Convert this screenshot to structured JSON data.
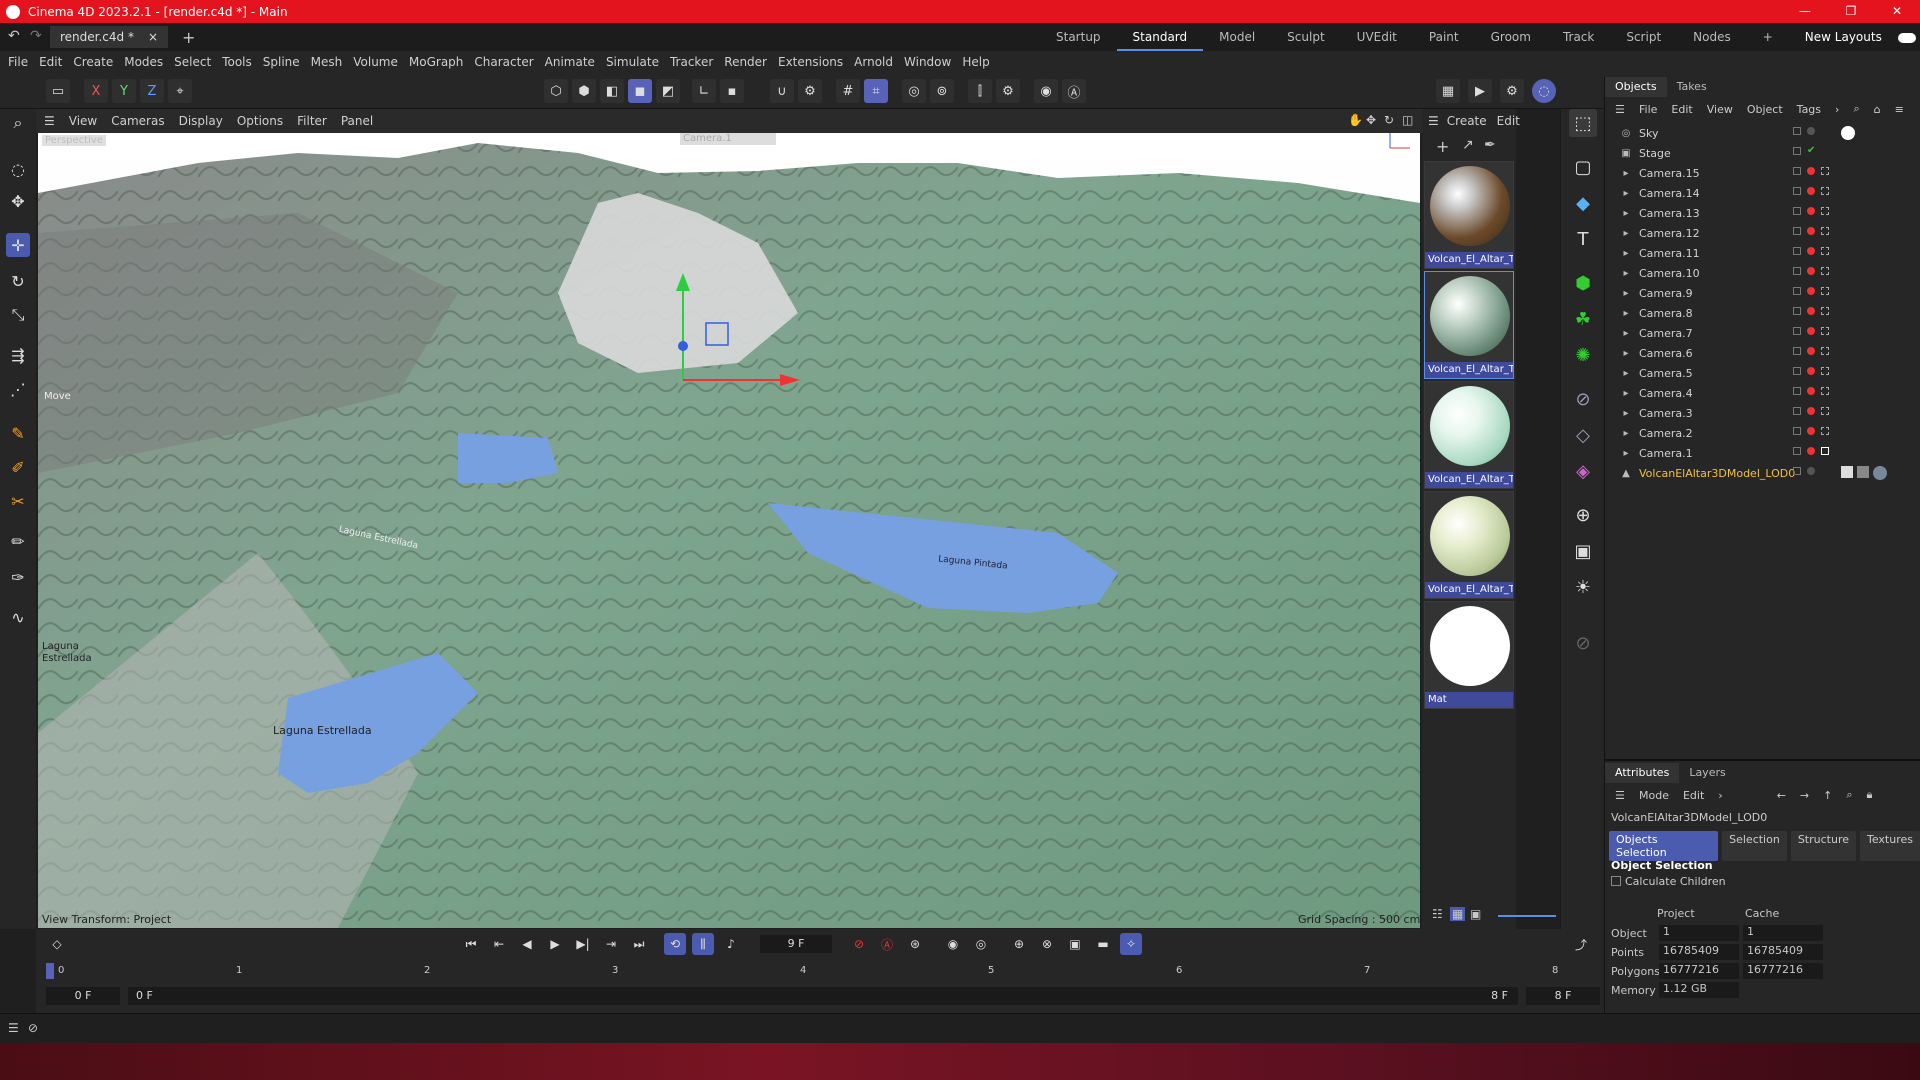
{
  "window": {
    "title": "Cinema 4D 2023.2.1 - [render.c4d *] - Main"
  },
  "doc_tab": {
    "name": "render.c4d *",
    "close": "×",
    "add": "+"
  },
  "layouts": {
    "items": [
      "Startup",
      "Standard",
      "Model",
      "Sculpt",
      "UVEdit",
      "Paint",
      "Groom",
      "Track",
      "Script",
      "Nodes"
    ],
    "add": "+",
    "new_layouts": "New Layouts",
    "active": "Standard"
  },
  "menu": [
    "File",
    "Edit",
    "Create",
    "Modes",
    "Select",
    "Tools",
    "Spline",
    "Mesh",
    "Volume",
    "MoGraph",
    "Character",
    "Animate",
    "Simulate",
    "Tracker",
    "Render",
    "Extensions",
    "Arnold",
    "Window",
    "Help"
  ],
  "toolbar": {
    "x": "X",
    "y": "Y",
    "z": "Z"
  },
  "viewport": {
    "menu": [
      "View",
      "Cameras",
      "Display",
      "Options",
      "Filter",
      "Panel"
    ],
    "label": "Perspective",
    "camera": "Camera.1",
    "status_left": "View Transform: Project",
    "status_right": "Grid Spacing : 500 cm",
    "move_label": "Move",
    "map_labels": [
      "Laguna Estrellada",
      "Laguna Pintada",
      "Laguna",
      "Estrellada"
    ]
  },
  "materials": {
    "menu": [
      "Create",
      "Edit"
    ],
    "items": [
      {
        "name": "Volcan_El_Altar_Te",
        "color": "#6b4a2a"
      },
      {
        "name": "Volcan_El_Altar_Te",
        "color": "#7a9a88"
      },
      {
        "name": "Volcan_El_Altar_Te",
        "color": "#a8d8c0"
      },
      {
        "name": "Volcan_El_Altar_Te",
        "color": "#b8c898"
      },
      {
        "name": "Mat",
        "color": "#ffffff"
      }
    ]
  },
  "objects": {
    "tabs": [
      "Objects",
      "Takes"
    ],
    "menu": [
      "File",
      "Edit",
      "View",
      "Object",
      "Tags"
    ],
    "items": [
      "Sky",
      "Stage",
      "Camera.15",
      "Camera.14",
      "Camera.13",
      "Camera.12",
      "Camera.11",
      "Camera.10",
      "Camera.9",
      "Camera.8",
      "Camera.7",
      "Camera.6",
      "Camera.5",
      "Camera.4",
      "Camera.3",
      "Camera.2",
      "Camera.1",
      "VolcanElAltar3DModel_LOD0"
    ]
  },
  "attributes": {
    "tabs": [
      "Attributes",
      "Layers"
    ],
    "menu": [
      "Mode",
      "Edit"
    ],
    "object_name": "VolcanElAltar3DModel_LOD0",
    "buttons": [
      "Objects Selection",
      "Selection",
      "Structure",
      "Textures"
    ],
    "section": "Object Selection",
    "calculate_children": "Calculate Children",
    "columns": [
      "Project",
      "Cache"
    ],
    "rows": [
      {
        "label": "Object",
        "project": "1",
        "cache": "1"
      },
      {
        "label": "Points",
        "project": "16785409",
        "cache": "16785409"
      },
      {
        "label": "Polygons",
        "project": "16777216",
        "cache": "16777216"
      },
      {
        "label": "Memory",
        "project": "1.12 GB",
        "cache": ""
      }
    ]
  },
  "timeline": {
    "current_frame": "9 F",
    "ticks": [
      "0",
      "1",
      "2",
      "3",
      "4",
      "5",
      "6",
      "7",
      "8"
    ],
    "range_start": "0 F",
    "range_min": "0 F",
    "range_max": "8 F",
    "range_end": "8 F"
  }
}
